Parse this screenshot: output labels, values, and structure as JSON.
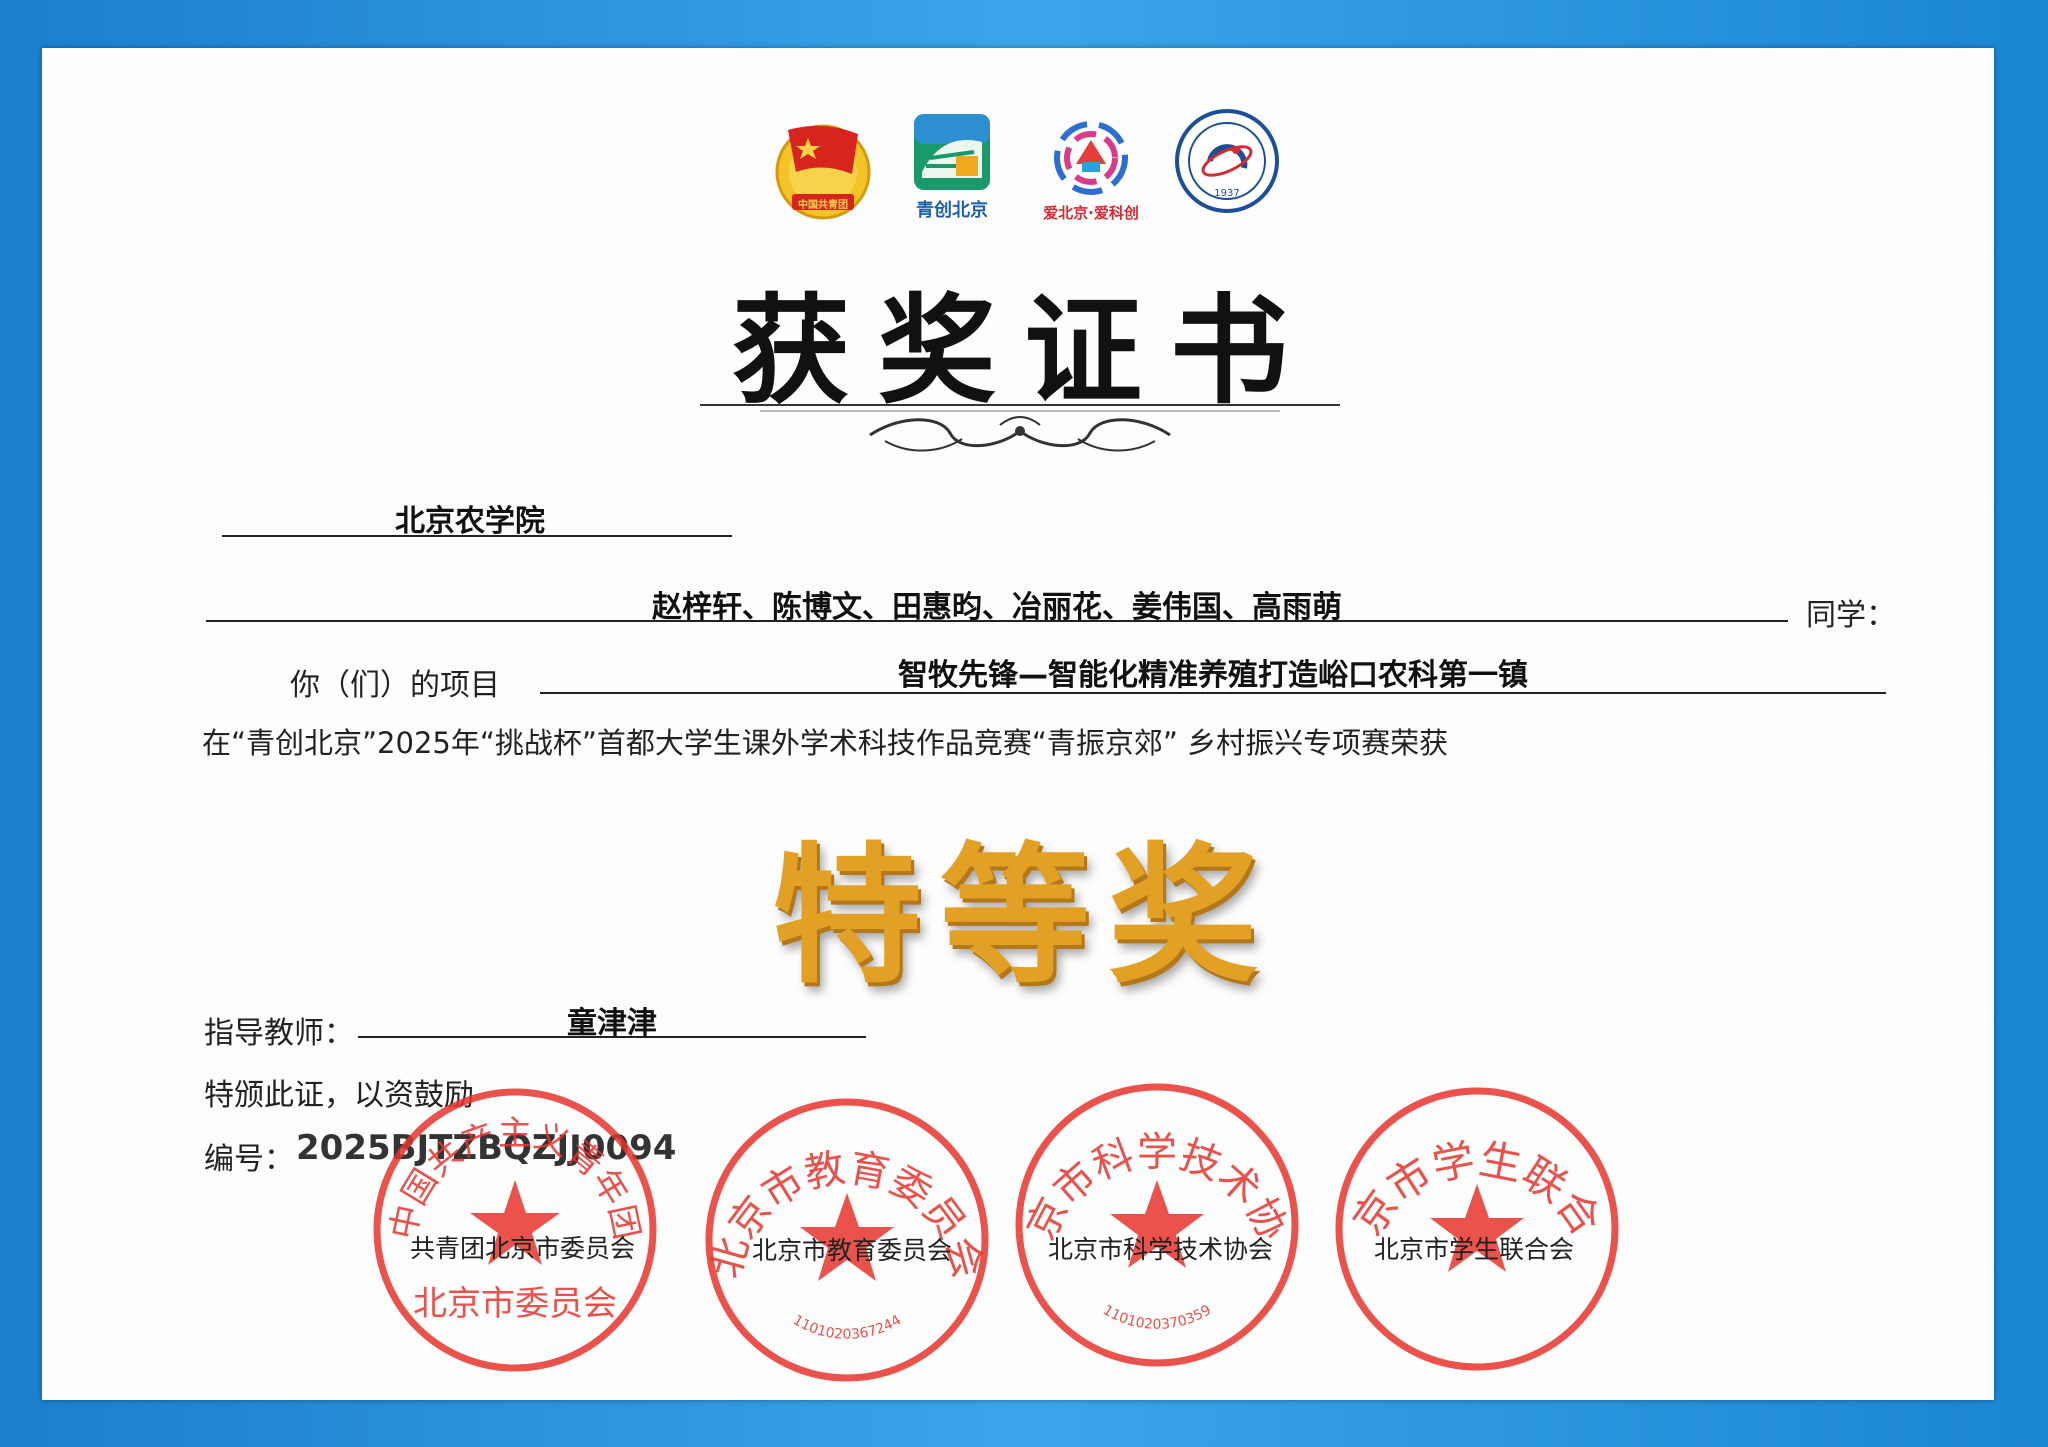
{
  "logos": {
    "league_text": "中国共青团",
    "qingchuang": "青创北京",
    "ai_beijing": "爱北京·爱科创",
    "univ_year": "1937"
  },
  "title": "获奖证书",
  "school": "北京农学院",
  "students": "赵梓轩、陈博文、田惠昀、冶丽花、姜伟国、高雨萌",
  "students_suffix": "同学：",
  "project_label": "你（们）的项目",
  "project_name": "智牧先锋—智能化精准养殖打造峪口农科第一镇",
  "competition_line": "在“青创北京”2025年“挑战杯”首都大学生课外学术科技作品竞赛“青振京郊” 乡村振兴专项赛荣获",
  "award": "特等奖",
  "advisor_label": "指导教师：",
  "advisor_name": "童津津",
  "issue_text": "特颁此证，以资鼓励",
  "serial_label": "编号：",
  "serial_value": "2025BJTZBQZJJ0094",
  "seals": [
    {
      "ring_text": "中国共产主义青年团",
      "bottom_text": "北京市委员会",
      "caption": "共青团北京市委员会"
    },
    {
      "ring_text": "北京市教育委员会",
      "code": "1101020367244",
      "caption": "北京市教育委员会"
    },
    {
      "ring_text": "北京市科学技术协会",
      "code": "1101020370359",
      "caption": "北京市科学技术协会"
    },
    {
      "ring_text": "北京市学生联合会",
      "caption": "北京市学生联合会"
    }
  ],
  "colors": {
    "frame_blue": "#1f8ed8",
    "seal_red": "#e8342c",
    "award_gold": "#e2a024",
    "ink": "#111111"
  }
}
